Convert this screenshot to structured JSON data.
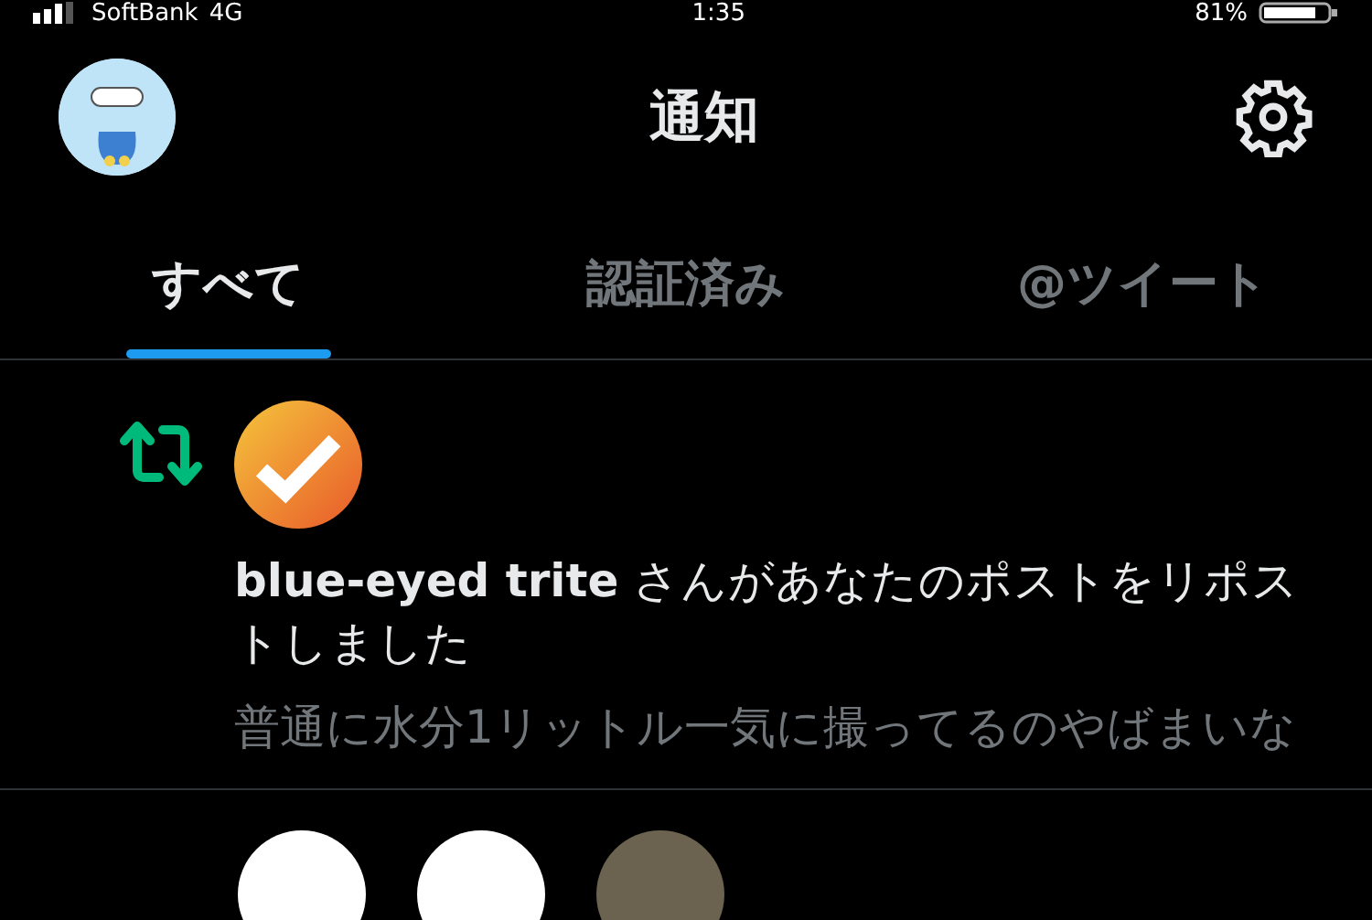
{
  "status_bar": {
    "carrier": "SoftBank",
    "network": "4G",
    "time": "1:35",
    "battery": "81%"
  },
  "header": {
    "title": "通知"
  },
  "tabs": [
    {
      "label": "すべて",
      "selected": true
    },
    {
      "label": "認証済み",
      "selected": false
    },
    {
      "label": "@ツイート",
      "selected": false
    }
  ],
  "notifications": [
    {
      "kind": "repost",
      "message": "**blue-eyed trite** さんがあなたのポストをリポストしました",
      "post": "普通に水分1リットル一気に撮ってるのやばまいな"
    }
  ]
}
